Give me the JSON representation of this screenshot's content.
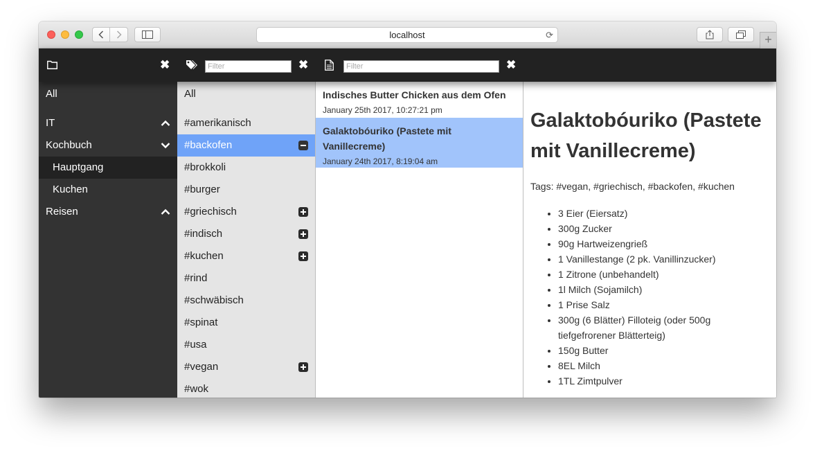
{
  "browser": {
    "url": "localhost"
  },
  "notebooks": {
    "items": [
      {
        "label": "All",
        "indent": false,
        "selected": false,
        "chevron": ""
      },
      {
        "label": "IT",
        "indent": false,
        "selected": false,
        "chevron": "up"
      },
      {
        "label": "Kochbuch",
        "indent": false,
        "selected": false,
        "chevron": "down"
      },
      {
        "label": "Hauptgang",
        "indent": true,
        "selected": true,
        "chevron": ""
      },
      {
        "label": "Kuchen",
        "indent": true,
        "selected": false,
        "chevron": ""
      },
      {
        "label": "Reisen",
        "indent": false,
        "selected": false,
        "chevron": "up"
      }
    ]
  },
  "tags": {
    "filter_placeholder": "Filter",
    "items": [
      {
        "label": "All",
        "action": ""
      },
      {
        "label": "#amerikanisch",
        "action": ""
      },
      {
        "label": "#backofen",
        "action": "minus",
        "active": true
      },
      {
        "label": "#brokkoli",
        "action": ""
      },
      {
        "label": "#burger",
        "action": ""
      },
      {
        "label": "#griechisch",
        "action": "plus"
      },
      {
        "label": "#indisch",
        "action": "plus"
      },
      {
        "label": "#kuchen",
        "action": "plus"
      },
      {
        "label": "#rind",
        "action": ""
      },
      {
        "label": "#schwäbisch",
        "action": ""
      },
      {
        "label": "#spinat",
        "action": ""
      },
      {
        "label": "#usa",
        "action": ""
      },
      {
        "label": "#vegan",
        "action": "plus"
      },
      {
        "label": "#wok",
        "action": ""
      }
    ]
  },
  "notes": {
    "filter_placeholder": "Filter",
    "items": [
      {
        "title": "Indisches Butter Chicken aus dem Ofen",
        "date": "January 25th 2017, 10:27:21 pm",
        "selected": false
      },
      {
        "title": "Galaktobóuriko (Pastete mit Vanillecreme)",
        "date": "January 24th 2017, 8:19:04 am",
        "selected": true
      }
    ]
  },
  "document": {
    "title": "Galaktobóuriko (Pastete mit Vanillecreme)",
    "tags_line": "Tags: #vegan, #griechisch, #backofen, #kuchen",
    "ingredients": [
      "3 Eier (Eiersatz)",
      "300g Zucker",
      "90g Hartweizengrieß",
      "1 Vanillestange (2 pk. Vanillinzucker)",
      "1 Zitrone (unbehandelt)",
      "1l Milch (Sojamilch)",
      "1 Prise Salz",
      "300g (6 Blätter) Filloteig (oder 500g tiefgefrorener Blätterteig)",
      "150g Butter",
      "8EL Milch",
      "1TL Zimtpulver"
    ]
  },
  "icons": {
    "close": "✖"
  }
}
